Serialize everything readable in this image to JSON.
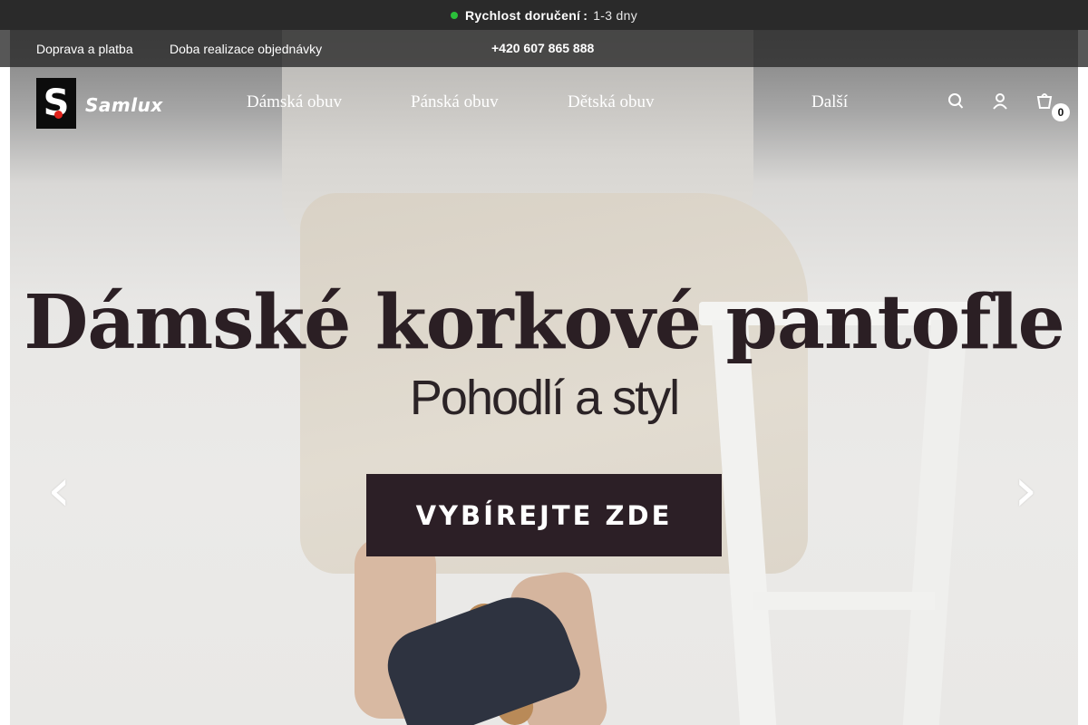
{
  "announcement": {
    "label": "Rychlost doručení",
    "info_glyph": "",
    "colon": ":",
    "value": "1-3 dny",
    "status_color": "#2bbf3a"
  },
  "subnav": {
    "links": [
      "Doprava a platba",
      "Doba realizace objednávky"
    ],
    "more_chevron": "",
    "phone_icon": "",
    "phone": "+420 607 865 888"
  },
  "brand": {
    "logo_letter": "S",
    "name": "Samlux",
    "accent": "#e0231c"
  },
  "main_nav": {
    "items": [
      {
        "label": "Dámská obuv",
        "chevron": ""
      },
      {
        "label": "Pánská obuv",
        "chevron": ""
      },
      {
        "label": "Dětská obuv",
        "chevron": ""
      }
    ],
    "more_icon": "",
    "more_label": "Další"
  },
  "header_icons": {
    "search": "search-icon",
    "account": "user-icon",
    "cart": "cart-icon",
    "cart_count": "0"
  },
  "hero": {
    "title": "Dámské korkové pantofle",
    "subtitle": "Pohodlí a styl",
    "cta_label": "VYBÍREJTE ZDE",
    "cta_color": "#2c1f26",
    "prev_arrow": "‹",
    "next_arrow": "›"
  }
}
